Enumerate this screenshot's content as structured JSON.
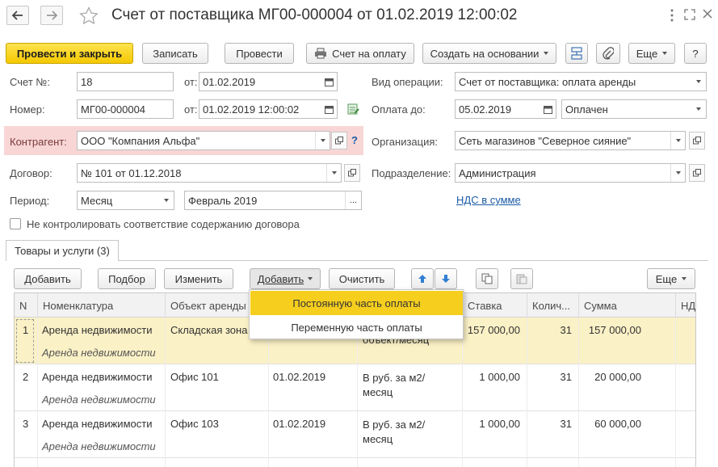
{
  "header": {
    "title": "Счет от поставщика МГ00-000004 от 01.02.2019 12:00:02",
    "back_icon": "arrow-left-icon",
    "forward_icon": "arrow-right-icon",
    "favorite_icon": "star-icon",
    "more_icon": "vertical-dots-icon",
    "maximize_icon": "maximize-icon",
    "close_icon": "close-icon"
  },
  "toolbar": {
    "post_close": "Провести и закрыть",
    "save": "Записать",
    "post": "Провести",
    "pay_invoice": "Счет на оплату",
    "create_based": "Создать на основании",
    "more": "Еще",
    "help": "?"
  },
  "form": {
    "invoice_no_label": "Счет №:",
    "invoice_no": "18",
    "from_label": "от:",
    "invoice_date": "01.02.2019",
    "number_label": "Номер:",
    "number": "МГ00-000004",
    "doc_datetime": "01.02.2019 12:00:02",
    "counterparty_label": "Контрагент:",
    "counterparty": "ООО \"Компания Альфа\"",
    "counterparty_help": "?",
    "contract_label": "Договор:",
    "contract": "№ 101 от 01.12.2018",
    "period_label": "Период:",
    "period_type": "Месяц",
    "period_value": "Февраль 2019",
    "period_more": "...",
    "nocontrol_label": "Не контролировать соответствие содержанию договора",
    "op_type_label": "Вид операции:",
    "op_type": "Счет от поставщика: оплата аренды",
    "pay_until_label": "Оплата до:",
    "pay_until": "05.02.2019",
    "pay_status": "Оплачен",
    "org_label": "Организация:",
    "org": "Сеть магазинов \"Северное сияние\"",
    "dept_label": "Подразделение:",
    "dept": "Администрация",
    "vat_link": "НДС в сумме"
  },
  "tabs": [
    {
      "label": "Товары и услуги (3)"
    }
  ],
  "table_toolbar": {
    "add": "Добавить",
    "pick": "Подбор",
    "edit": "Изменить",
    "add_menu": "Добавить",
    "clear": "Очистить",
    "more": "Еще"
  },
  "dropdown": {
    "items": [
      "Постоянную часть оплаты",
      "Переменную часть оплаты"
    ]
  },
  "table": {
    "columns": [
      "N",
      "Номенклатура",
      "Объект аренды",
      "",
      "",
      "Ставка",
      "Колич...",
      "Сумма",
      "НДС"
    ],
    "rows": [
      {
        "n": "1",
        "item": "Аренда недвижимости",
        "item_sub": "Аренда недвижимости",
        "object": "Складская зона",
        "date": "",
        "unit": "объект/месяц",
        "rate": "157 000,00",
        "qty": "31",
        "sum": "157 000,00"
      },
      {
        "n": "2",
        "item": "Аренда недвижимости",
        "item_sub": "Аренда недвижимости",
        "object": "Офис 101",
        "date": "01.02.2019",
        "unit": "В руб. за м2/месяц",
        "rate": "1 000,00",
        "qty": "31",
        "sum": "20 000,00"
      },
      {
        "n": "3",
        "item": "Аренда недвижимости",
        "item_sub": "Аренда недвижимости",
        "object": "Офис 103",
        "date": "01.02.2019",
        "unit": "В руб. за м2/месяц",
        "rate": "1 000,00",
        "qty": "31",
        "sum": "60 000,00"
      }
    ]
  },
  "colors": {
    "primary": "#f4c800",
    "highlight": "#f6ce1e",
    "selected_row": "#fbf1c6",
    "error_bg": "#f8d6d6",
    "link": "#1a5aa6"
  }
}
